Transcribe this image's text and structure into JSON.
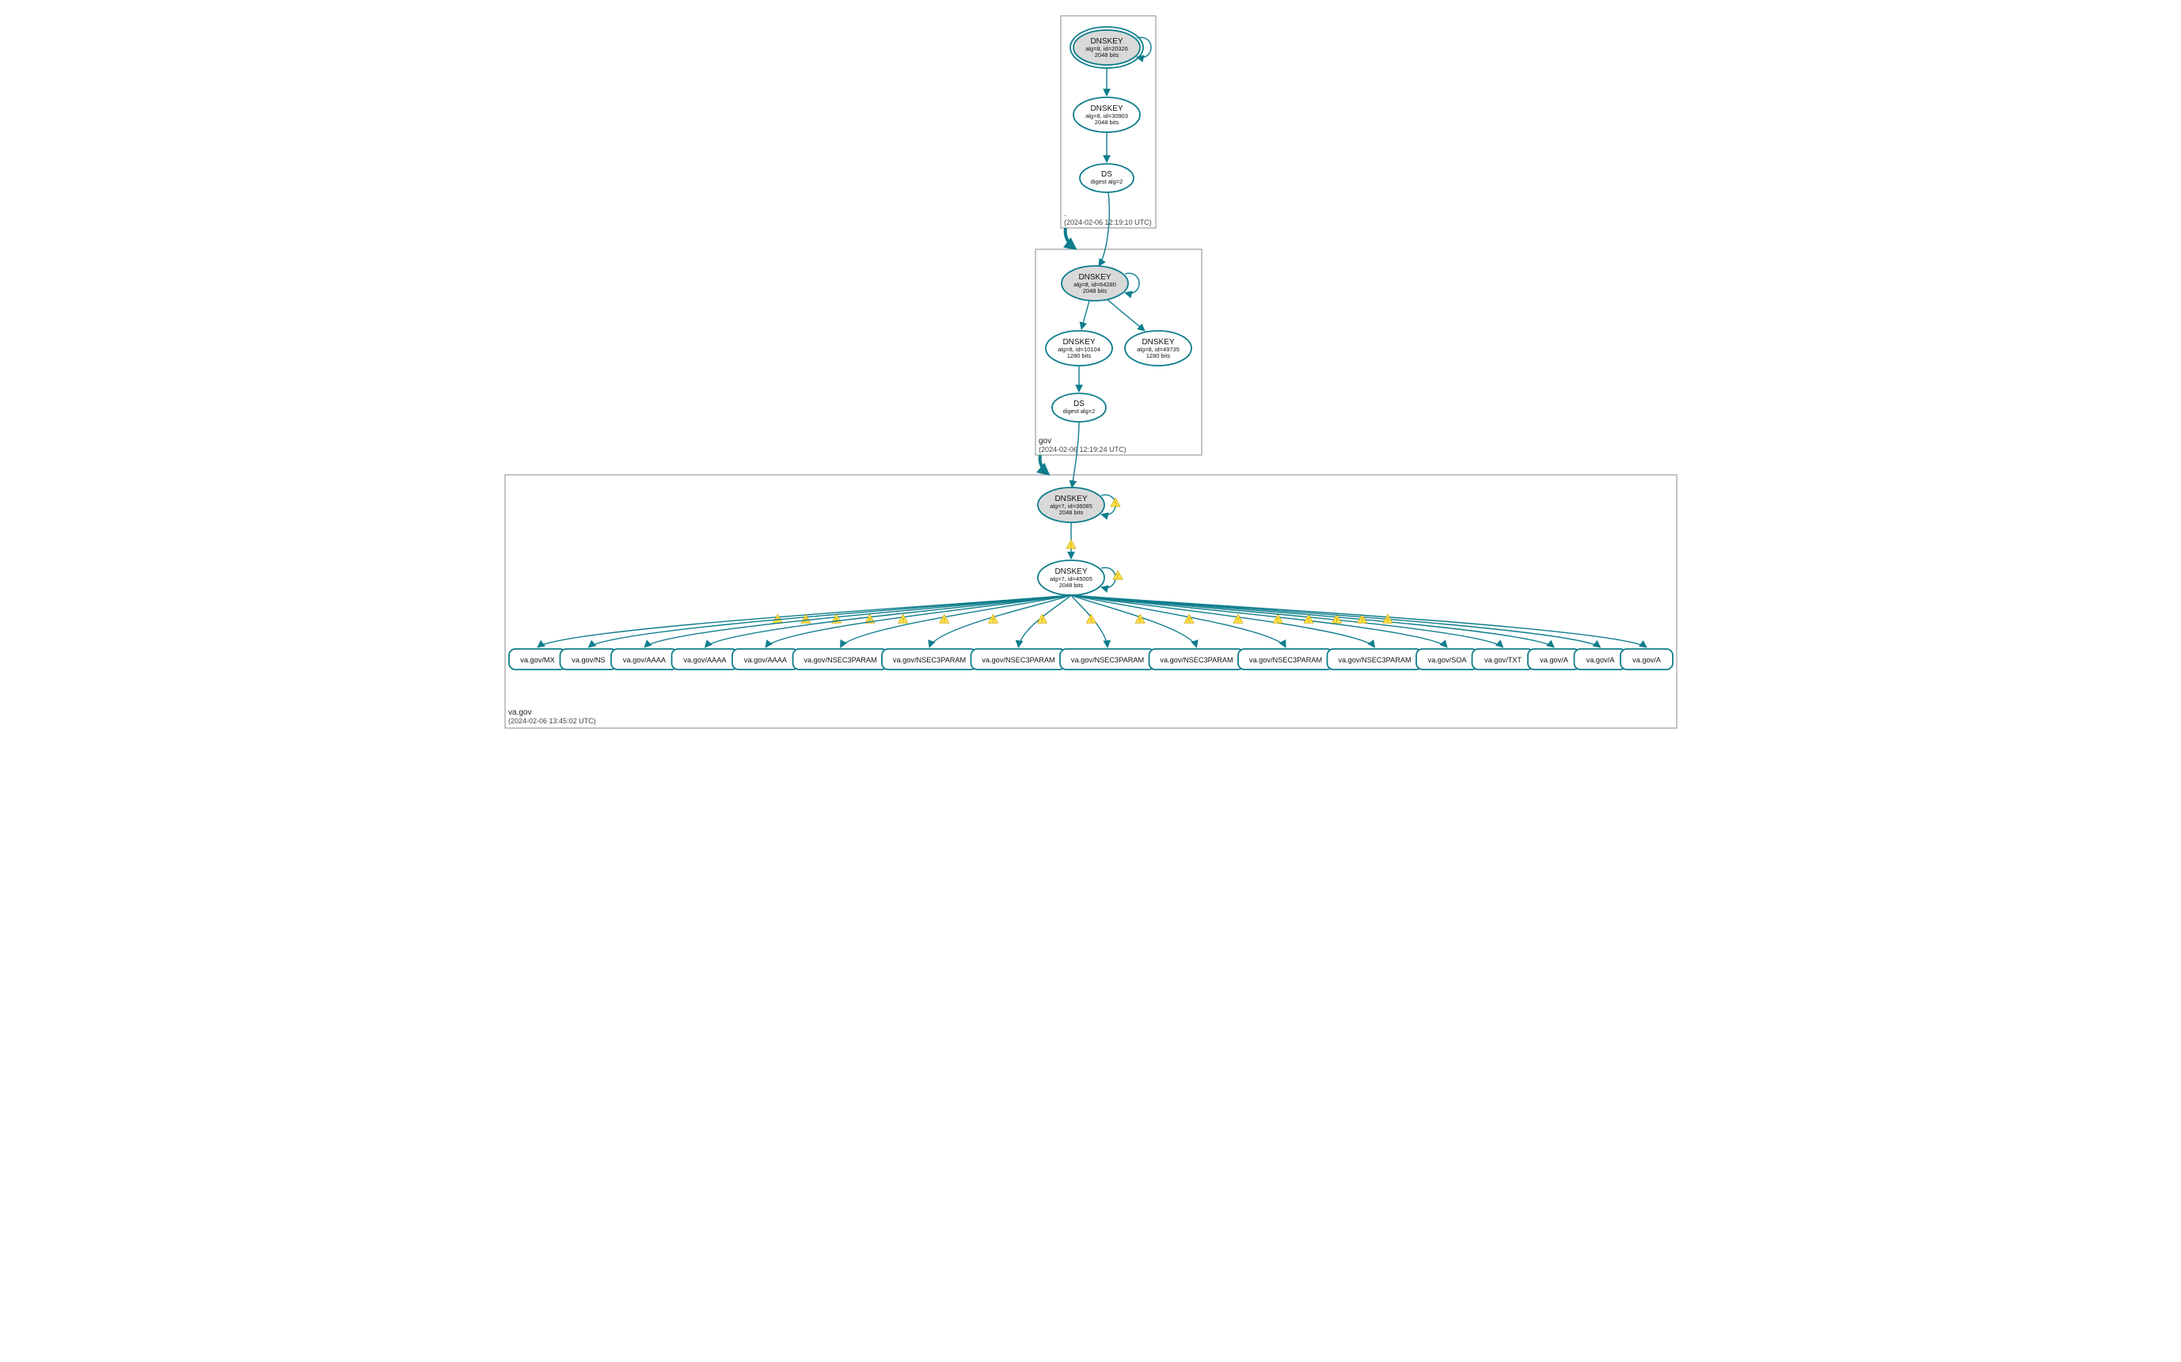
{
  "zones": {
    "root": {
      "label": ".",
      "timestamp": "(2024-02-06 12:19:10 UTC)"
    },
    "gov": {
      "label": "gov",
      "timestamp": "(2024-02-06 12:19:24 UTC)"
    },
    "vagov": {
      "label": "va.gov",
      "timestamp": "(2024-02-06 13:45:02 UTC)"
    }
  },
  "nodes": {
    "root_ksk": {
      "title": "DNSKEY",
      "line2": "alg=8, id=20326",
      "line3": "2048 bits"
    },
    "root_zsk": {
      "title": "DNSKEY",
      "line2": "alg=8, id=30903",
      "line3": "2048 bits"
    },
    "root_ds": {
      "title": "DS",
      "line2": "digest alg=2"
    },
    "gov_ksk": {
      "title": "DNSKEY",
      "line2": "alg=8, id=64280",
      "line3": "2048 bits"
    },
    "gov_zsk1": {
      "title": "DNSKEY",
      "line2": "alg=8, id=10104",
      "line3": "1280 bits"
    },
    "gov_zsk2": {
      "title": "DNSKEY",
      "line2": "alg=8, id=49735",
      "line3": "1280 bits"
    },
    "gov_ds": {
      "title": "DS",
      "line2": "digest alg=2"
    },
    "vagov_ksk": {
      "title": "DNSKEY",
      "line2": "alg=7, id=36085",
      "line3": "2048 bits"
    },
    "vagov_zsk": {
      "title": "DNSKEY",
      "line2": "alg=7, id=45005",
      "line3": "2048 bits"
    }
  },
  "rrsets": [
    "va.gov/MX",
    "va.gov/NS",
    "va.gov/AAAA",
    "va.gov/AAAA",
    "va.gov/AAAA",
    "va.gov/NSEC3PARAM",
    "va.gov/NSEC3PARAM",
    "va.gov/NSEC3PARAM",
    "va.gov/NSEC3PARAM",
    "va.gov/NSEC3PARAM",
    "va.gov/NSEC3PARAM",
    "va.gov/NSEC3PARAM",
    "va.gov/SOA",
    "va.gov/TXT",
    "va.gov/A",
    "va.gov/A",
    "va.gov/A"
  ],
  "colors": {
    "stroke": "#0e7d8c",
    "ksk_fill": "#d9d9d9",
    "warn_fill": "#ffe14d",
    "warn_stroke": "#c9a400"
  }
}
